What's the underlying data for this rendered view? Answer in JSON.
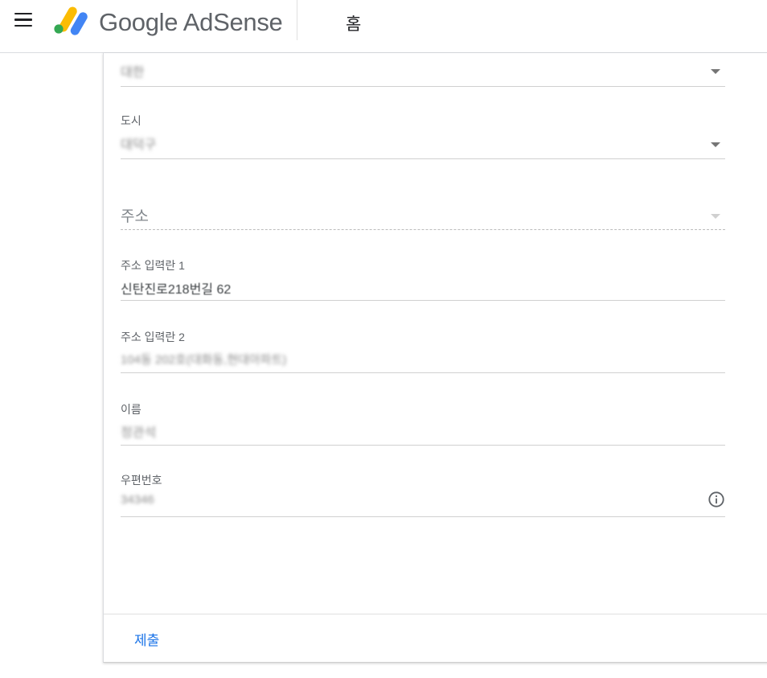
{
  "header": {
    "brand": "Google AdSense",
    "page_title": "홈"
  },
  "form": {
    "country": {
      "value": "대한"
    },
    "city": {
      "label": "도시",
      "value": "대덕구"
    },
    "address": {
      "placeholder": "주소"
    },
    "address_line1": {
      "label": "주소 입력란 1",
      "value": "신탄진로218번길 62"
    },
    "address_line2": {
      "label": "주소 입력란 2",
      "value": "104동 202호(대화동,현대아파트)"
    },
    "name": {
      "label": "이름",
      "value": "정관석"
    },
    "postal_code": {
      "label": "우편번호",
      "value": "34346"
    }
  },
  "footer": {
    "submit_label": "제출"
  },
  "colors": {
    "accent": "#1a73e8",
    "logo_yellow": "#fbbc04",
    "logo_blue": "#4285f4",
    "logo_green": "#34a853"
  }
}
